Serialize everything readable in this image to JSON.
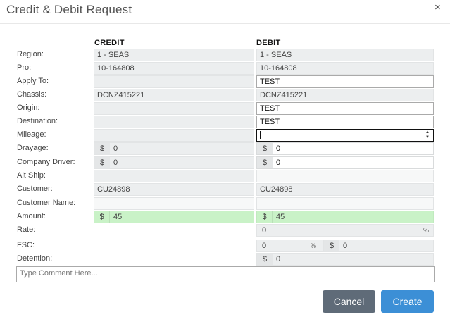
{
  "dialog": {
    "title": "Credit & Debit Request",
    "close_icon": "×"
  },
  "columns": {
    "credit": "CREDIT",
    "debit": "DEBIT"
  },
  "labels": {
    "region": "Region:",
    "pro": "Pro:",
    "apply_to": "Apply To:",
    "chassis": "Chassis:",
    "origin": "Origin:",
    "destination": "Destination:",
    "mileage": "Mileage:",
    "drayage": "Drayage:",
    "company_driver": "Company Driver:",
    "alt_ship": "Alt Ship:",
    "customer": "Customer:",
    "customer_name": "Customer Name:",
    "amount": "Amount:",
    "rate": "Rate:",
    "fsc": "FSC:",
    "detention": "Detention:"
  },
  "credit": {
    "region": "1 - SEAS",
    "pro": "10-164808",
    "apply_to": "",
    "chassis": "DCNZ415221",
    "origin": "",
    "destination": "",
    "mileage": "",
    "drayage_prefix": "$",
    "drayage": "0",
    "company_driver_prefix": "$",
    "company_driver": "0",
    "alt_ship": "",
    "customer": "CU24898",
    "customer_name": "",
    "amount_prefix": "$",
    "amount": "45"
  },
  "debit": {
    "region": "1 - SEAS",
    "pro": "10-164808",
    "apply_to": "TEST",
    "chassis": "DCNZ415221",
    "origin": "TEST",
    "destination": "TEST",
    "mileage": "",
    "drayage_prefix": "$",
    "drayage": "0",
    "company_driver_prefix": "$",
    "company_driver": "0",
    "alt_ship": "",
    "customer": "CU24898",
    "customer_name": "",
    "amount_prefix": "$",
    "amount": "45",
    "rate": "0",
    "rate_suffix": "%",
    "fsc_percent": "0",
    "fsc_percent_suffix": "%",
    "fsc_dollar_prefix": "$",
    "fsc_dollar": "0",
    "detention_prefix": "$",
    "detention": "0"
  },
  "comment": {
    "placeholder": "Type Comment Here..."
  },
  "buttons": {
    "cancel": "Cancel",
    "create": "Create"
  },
  "colors": {
    "amount_highlight": "#c9f2c7",
    "create_button": "#3c8fd6",
    "cancel_button": "#5f6b78"
  }
}
